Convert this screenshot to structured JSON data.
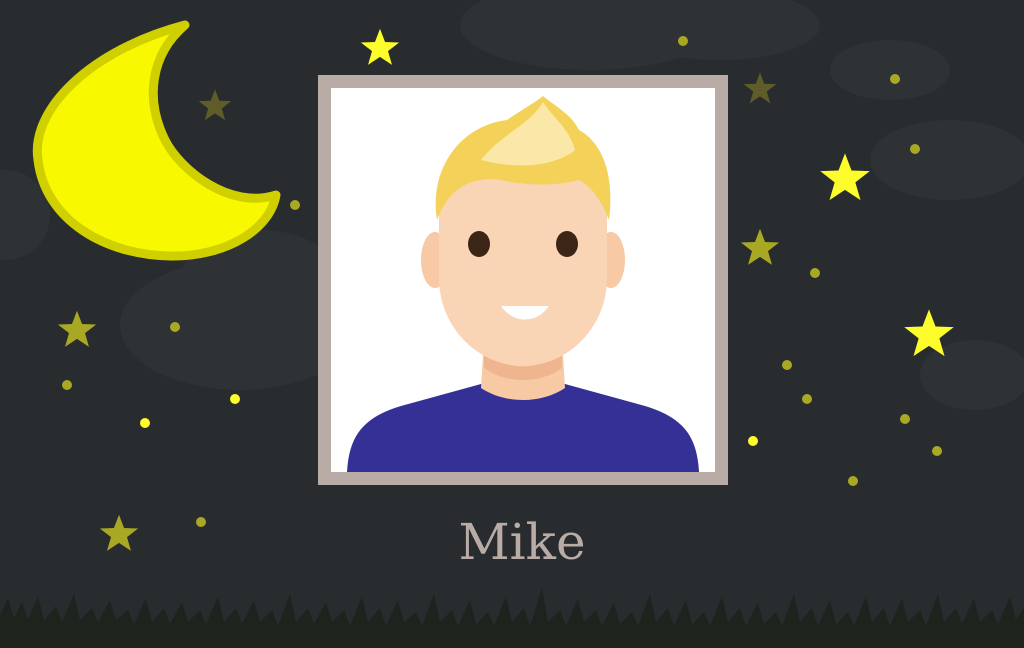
{
  "profile": {
    "name": "Mike",
    "avatar_icon": "male-avatar-icon"
  },
  "colors": {
    "background": "#282c2f",
    "frame": "#b9aba6",
    "name_text": "#b9aba6",
    "star_bright": "#fdfd2c",
    "star_dim": "#a9a825",
    "star_faint": "#5e5d29",
    "moon": "#f8f800",
    "moon_outline": "#d4d400",
    "grass": "#1f231d"
  },
  "decor": {
    "moon_icon": "crescent-moon-icon",
    "star_icon": "star-icon",
    "grass_icon": "grass-icon"
  }
}
